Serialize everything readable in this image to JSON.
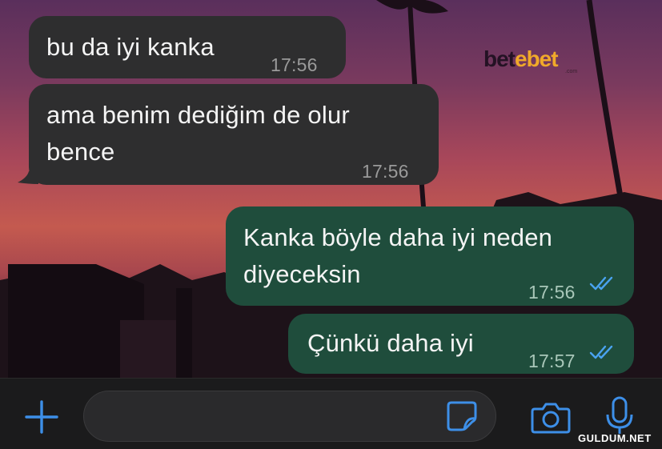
{
  "messages": [
    {
      "direction": "incoming",
      "text": "bu da iyi kanka",
      "time": "17:56"
    },
    {
      "direction": "incoming",
      "text": "ama benim dediğim de olur bence",
      "time": "17:56"
    },
    {
      "direction": "outgoing",
      "text": "Kanka böyle daha iyi neden diyeceksin",
      "time": "17:56",
      "status": "read"
    },
    {
      "direction": "outgoing",
      "text": "Çünkü daha iyi",
      "time": "17:57",
      "status": "read"
    }
  ],
  "overlay_logo": {
    "part1": "bet",
    "part2": "e",
    "part3": "bet",
    "sub": ".com"
  },
  "watermark": "GULDUM.NET",
  "colors": {
    "incoming_bubble": "#2e2e2f",
    "outgoing_bubble": "#1f4d3c",
    "accent_blue": "#3d8fe8",
    "read_ticks": "#4aa3f0"
  },
  "input": {
    "placeholder": ""
  },
  "icons": [
    "plus-icon",
    "sticker-icon",
    "camera-icon",
    "microphone-icon"
  ]
}
